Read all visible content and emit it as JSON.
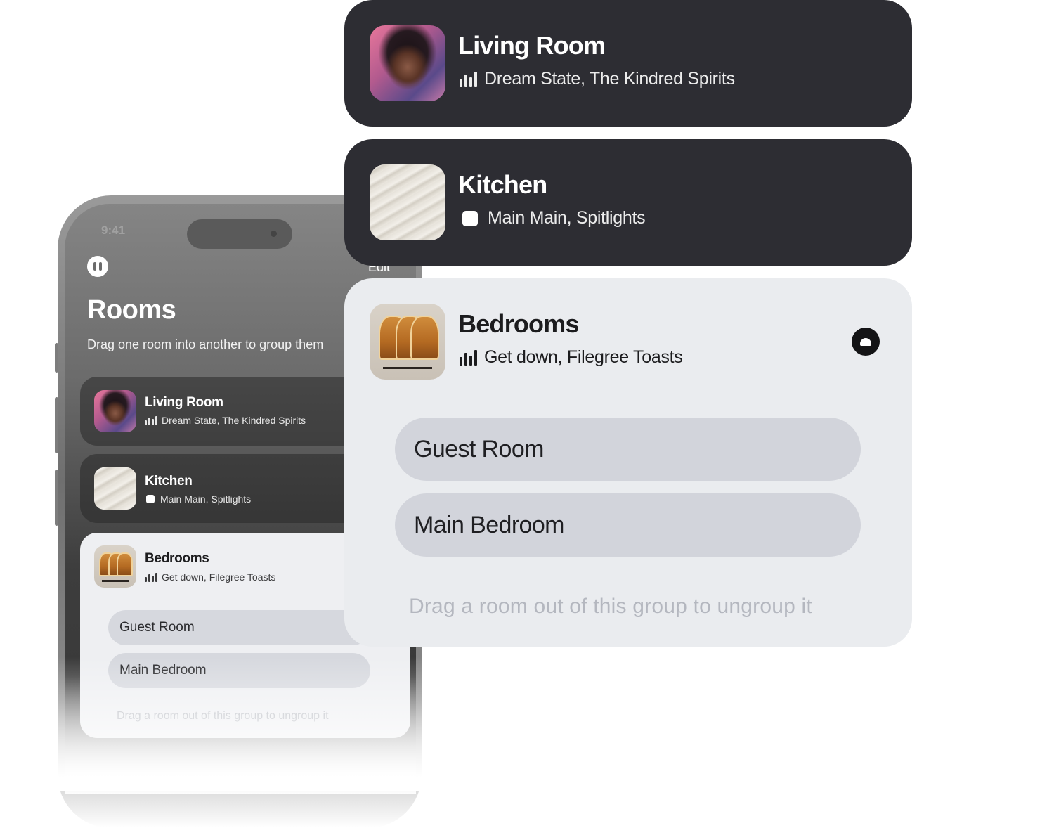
{
  "phone": {
    "status_time": "9:41",
    "edit_label": "Edit",
    "title": "Rooms",
    "hint": "Drag one room into another to group them",
    "rooms": [
      {
        "name": "Living Room",
        "status_icon": "equalizer-icon",
        "subtitle": "Dream State, The Kindred Spirits"
      },
      {
        "name": "Kitchen",
        "status_icon": "stop-icon",
        "subtitle": "Main Main, Spitlights"
      },
      {
        "name": "Bedrooms",
        "status_icon": "equalizer-icon",
        "subtitle": "Get down, Filegree Toasts"
      }
    ],
    "group_members": [
      "Guest Room",
      "Main Bedroom"
    ],
    "group_footer": "Drag a room out of this group to ungroup it"
  },
  "cards": {
    "living_room": {
      "name": "Living Room",
      "status_icon": "equalizer-icon",
      "subtitle": "Dream State, The Kindred Spirits"
    },
    "kitchen": {
      "name": "Kitchen",
      "status_icon": "stop-icon",
      "subtitle": "Main Main, Spitlights"
    },
    "bedrooms": {
      "name": "Bedrooms",
      "status_icon": "equalizer-icon",
      "subtitle": "Get down, Filegree Toasts",
      "action_icon": "cloud-icon",
      "members": [
        "Guest Room",
        "Main Bedroom"
      ],
      "footer": "Drag a room out of this group to ungroup it"
    }
  },
  "colors": {
    "dark_card": "#2d2d33",
    "light_card": "#eaecef",
    "pill": "#d2d4db",
    "footer_text": "#b4b7bf"
  }
}
